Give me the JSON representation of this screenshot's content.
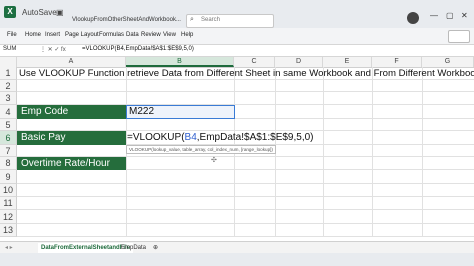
{
  "titlebar": {
    "app_icon_letter": "X",
    "autosave_label": "AutoSave",
    "filename": "VlookupFromOtherSheetAndWorkbook...",
    "search_placeholder": "Search"
  },
  "ribbon": {
    "tabs": [
      "File",
      "Home",
      "Insert",
      "Page Layout",
      "Formulas",
      "Data",
      "Review",
      "View",
      "Help"
    ]
  },
  "formula_bar": {
    "name_box": "SUM",
    "buttons": "⋮  ✕  ✓  fx",
    "formula": "=VLOOKUP(B4,EmpData!$A$1:$E$9,5,0)"
  },
  "columns": [
    "A",
    "B",
    "C",
    "D",
    "E",
    "F",
    "G"
  ],
  "rows": [
    "1",
    "2",
    "3",
    "4",
    "5",
    "6",
    "7",
    "8",
    "9",
    "10",
    "11",
    "12",
    "13"
  ],
  "cells": {
    "title": "Use VLOOKUP Function retrieve Data from Different Sheet in same Workbook and From Different Workbook",
    "emp_code_label": "Emp Code",
    "emp_code_value": "M222",
    "basic_pay_label": "Basic Pay",
    "basic_pay_formula_prefix": "=VLOOKUP(",
    "basic_pay_formula_ref": "B4",
    "basic_pay_formula_suffix": ",EmpData!$A$1:$E$9,5,0)",
    "overtime_label": "Overtime Rate/Hour"
  },
  "tooltip": "VLOOKUP(lookup_value, table_array, col_index_num, [range_lookup])",
  "sheets": [
    "DataFromExternalSheetandFile",
    "EmpData"
  ],
  "colors": {
    "excel_green": "#1d6f42",
    "label_fill": "#256d3c",
    "ref_blue": "#2f5fcf"
  }
}
